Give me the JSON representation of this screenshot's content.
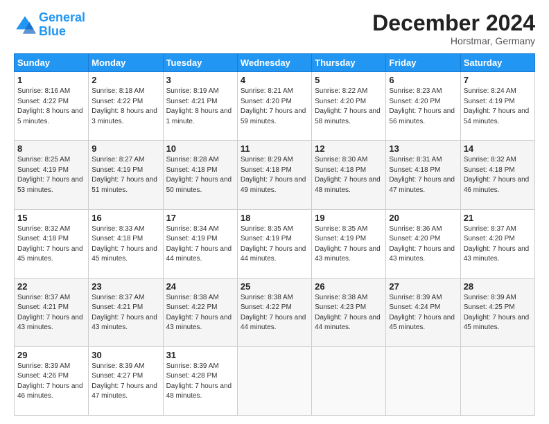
{
  "header": {
    "logo_line1": "General",
    "logo_line2": "Blue",
    "month_title": "December 2024",
    "location": "Horstmar, Germany"
  },
  "weekdays": [
    "Sunday",
    "Monday",
    "Tuesday",
    "Wednesday",
    "Thursday",
    "Friday",
    "Saturday"
  ],
  "weeks": [
    [
      {
        "day": "1",
        "sunrise": "8:16 AM",
        "sunset": "4:22 PM",
        "daylight": "8 hours and 5 minutes."
      },
      {
        "day": "2",
        "sunrise": "8:18 AM",
        "sunset": "4:22 PM",
        "daylight": "8 hours and 3 minutes."
      },
      {
        "day": "3",
        "sunrise": "8:19 AM",
        "sunset": "4:21 PM",
        "daylight": "8 hours and 1 minute."
      },
      {
        "day": "4",
        "sunrise": "8:21 AM",
        "sunset": "4:20 PM",
        "daylight": "7 hours and 59 minutes."
      },
      {
        "day": "5",
        "sunrise": "8:22 AM",
        "sunset": "4:20 PM",
        "daylight": "7 hours and 58 minutes."
      },
      {
        "day": "6",
        "sunrise": "8:23 AM",
        "sunset": "4:20 PM",
        "daylight": "7 hours and 56 minutes."
      },
      {
        "day": "7",
        "sunrise": "8:24 AM",
        "sunset": "4:19 PM",
        "daylight": "7 hours and 54 minutes."
      }
    ],
    [
      {
        "day": "8",
        "sunrise": "8:25 AM",
        "sunset": "4:19 PM",
        "daylight": "7 hours and 53 minutes."
      },
      {
        "day": "9",
        "sunrise": "8:27 AM",
        "sunset": "4:19 PM",
        "daylight": "7 hours and 51 minutes."
      },
      {
        "day": "10",
        "sunrise": "8:28 AM",
        "sunset": "4:18 PM",
        "daylight": "7 hours and 50 minutes."
      },
      {
        "day": "11",
        "sunrise": "8:29 AM",
        "sunset": "4:18 PM",
        "daylight": "7 hours and 49 minutes."
      },
      {
        "day": "12",
        "sunrise": "8:30 AM",
        "sunset": "4:18 PM",
        "daylight": "7 hours and 48 minutes."
      },
      {
        "day": "13",
        "sunrise": "8:31 AM",
        "sunset": "4:18 PM",
        "daylight": "7 hours and 47 minutes."
      },
      {
        "day": "14",
        "sunrise": "8:32 AM",
        "sunset": "4:18 PM",
        "daylight": "7 hours and 46 minutes."
      }
    ],
    [
      {
        "day": "15",
        "sunrise": "8:32 AM",
        "sunset": "4:18 PM",
        "daylight": "7 hours and 45 minutes."
      },
      {
        "day": "16",
        "sunrise": "8:33 AM",
        "sunset": "4:18 PM",
        "daylight": "7 hours and 45 minutes."
      },
      {
        "day": "17",
        "sunrise": "8:34 AM",
        "sunset": "4:19 PM",
        "daylight": "7 hours and 44 minutes."
      },
      {
        "day": "18",
        "sunrise": "8:35 AM",
        "sunset": "4:19 PM",
        "daylight": "7 hours and 44 minutes."
      },
      {
        "day": "19",
        "sunrise": "8:35 AM",
        "sunset": "4:19 PM",
        "daylight": "7 hours and 43 minutes."
      },
      {
        "day": "20",
        "sunrise": "8:36 AM",
        "sunset": "4:20 PM",
        "daylight": "7 hours and 43 minutes."
      },
      {
        "day": "21",
        "sunrise": "8:37 AM",
        "sunset": "4:20 PM",
        "daylight": "7 hours and 43 minutes."
      }
    ],
    [
      {
        "day": "22",
        "sunrise": "8:37 AM",
        "sunset": "4:21 PM",
        "daylight": "7 hours and 43 minutes."
      },
      {
        "day": "23",
        "sunrise": "8:37 AM",
        "sunset": "4:21 PM",
        "daylight": "7 hours and 43 minutes."
      },
      {
        "day": "24",
        "sunrise": "8:38 AM",
        "sunset": "4:22 PM",
        "daylight": "7 hours and 43 minutes."
      },
      {
        "day": "25",
        "sunrise": "8:38 AM",
        "sunset": "4:22 PM",
        "daylight": "7 hours and 44 minutes."
      },
      {
        "day": "26",
        "sunrise": "8:38 AM",
        "sunset": "4:23 PM",
        "daylight": "7 hours and 44 minutes."
      },
      {
        "day": "27",
        "sunrise": "8:39 AM",
        "sunset": "4:24 PM",
        "daylight": "7 hours and 45 minutes."
      },
      {
        "day": "28",
        "sunrise": "8:39 AM",
        "sunset": "4:25 PM",
        "daylight": "7 hours and 45 minutes."
      }
    ],
    [
      {
        "day": "29",
        "sunrise": "8:39 AM",
        "sunset": "4:26 PM",
        "daylight": "7 hours and 46 minutes."
      },
      {
        "day": "30",
        "sunrise": "8:39 AM",
        "sunset": "4:27 PM",
        "daylight": "7 hours and 47 minutes."
      },
      {
        "day": "31",
        "sunrise": "8:39 AM",
        "sunset": "4:28 PM",
        "daylight": "7 hours and 48 minutes."
      },
      null,
      null,
      null,
      null
    ]
  ]
}
